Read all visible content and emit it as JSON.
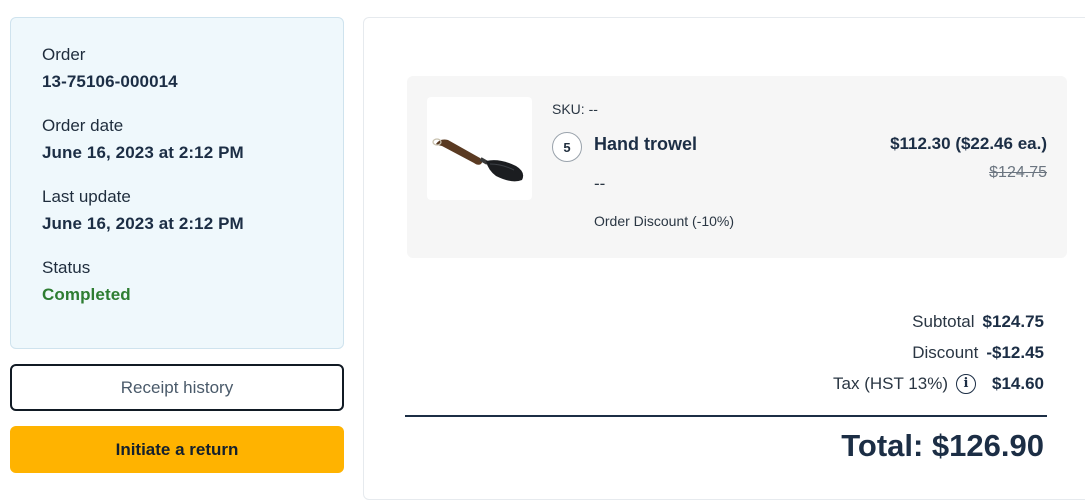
{
  "order_info": {
    "order_label": "Order",
    "order_number": "13-75106-000014",
    "order_date_label": "Order date",
    "order_date": "June 16, 2023 at 2:12 PM",
    "last_update_label": "Last update",
    "last_update": "June 16, 2023 at 2:12 PM",
    "status_label": "Status",
    "status": "Completed",
    "status_color": "#2e7d32"
  },
  "actions": {
    "receipt_history": "Receipt history",
    "initiate_return": "Initiate a return",
    "return_button_color": "#ffb300"
  },
  "line_item": {
    "sku": "SKU: --",
    "quantity": "5",
    "name": "Hand trowel",
    "variant": "--",
    "discount": "Order Discount (-10%)",
    "price": "$112.30 ($22.46 ea.)",
    "original_price": "$124.75",
    "image_icon": "hand-trowel-image"
  },
  "totals": {
    "subtotal_label": "Subtotal",
    "subtotal": "$124.75",
    "discount_label": "Discount",
    "discount": "-$12.45",
    "tax_label": "Tax (HST 13%)",
    "tax_info_icon": "i",
    "tax": "$14.60",
    "grand_total": "Total: $126.90"
  }
}
